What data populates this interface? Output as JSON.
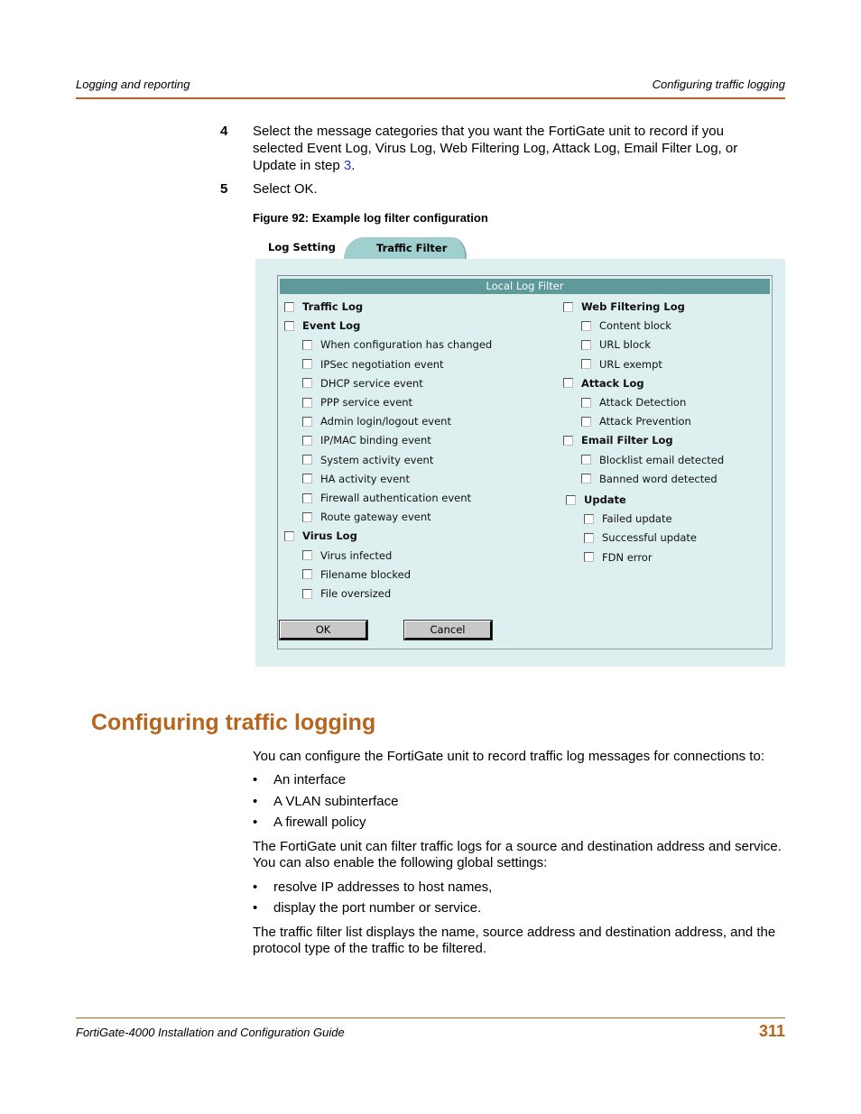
{
  "header": {
    "left": "Logging and reporting",
    "right": "Configuring traffic logging"
  },
  "steps": [
    {
      "num": "4",
      "text_before": "Select the message categories that you want the FortiGate unit to record if you selected Event Log, Virus Log, Web Filtering Log, Attack Log, Email Filter Log, or Update in step ",
      "link": "3",
      "text_after": "."
    },
    {
      "num": "5",
      "text": "Select OK."
    }
  ],
  "figure_caption": "Figure 92: Example log filter configuration",
  "screenshot": {
    "tabs": {
      "active": "Log Setting",
      "inactive": "Traffic Filter"
    },
    "panel_title": "Local Log Filter",
    "left_column": [
      {
        "label": "Traffic Log",
        "bold": true,
        "level": 0,
        "checked": false
      },
      {
        "label": "Event Log",
        "bold": true,
        "level": 0,
        "checked": false
      },
      {
        "label": "When configuration has changed",
        "bold": false,
        "level": 1,
        "checked": false
      },
      {
        "label": "IPSec negotiation event",
        "bold": false,
        "level": 1,
        "checked": false
      },
      {
        "label": "DHCP service event",
        "bold": false,
        "level": 1,
        "checked": false
      },
      {
        "label": "PPP service event",
        "bold": false,
        "level": 1,
        "checked": false
      },
      {
        "label": "Admin login/logout event",
        "bold": false,
        "level": 1,
        "checked": false
      },
      {
        "label": "IP/MAC binding event",
        "bold": false,
        "level": 1,
        "checked": false
      },
      {
        "label": "System activity event",
        "bold": false,
        "level": 1,
        "checked": false
      },
      {
        "label": "HA activity event",
        "bold": false,
        "level": 1,
        "checked": false
      },
      {
        "label": "Firewall authentication event",
        "bold": false,
        "level": 1,
        "checked": false
      },
      {
        "label": "Route gateway event",
        "bold": false,
        "level": 1,
        "checked": false
      },
      {
        "label": "Virus Log",
        "bold": true,
        "level": 0,
        "checked": false
      },
      {
        "label": "Virus infected",
        "bold": false,
        "level": 1,
        "checked": false
      },
      {
        "label": "Filename blocked",
        "bold": false,
        "level": 1,
        "checked": false
      },
      {
        "label": "File oversized",
        "bold": false,
        "level": 1,
        "checked": false
      }
    ],
    "right_column": [
      {
        "label": "Web Filtering Log",
        "bold": true,
        "level": 0,
        "checked": false
      },
      {
        "label": "Content block",
        "bold": false,
        "level": 1,
        "checked": false
      },
      {
        "label": "URL block",
        "bold": false,
        "level": 1,
        "checked": false
      },
      {
        "label": "URL exempt",
        "bold": false,
        "level": 1,
        "checked": false
      },
      {
        "label": "Attack Log",
        "bold": true,
        "level": 0,
        "checked": false
      },
      {
        "label": "Attack Detection",
        "bold": false,
        "level": 1,
        "checked": false
      },
      {
        "label": "Attack Prevention",
        "bold": false,
        "level": 1,
        "checked": false
      },
      {
        "label": "Email Filter Log",
        "bold": true,
        "level": 0,
        "checked": false
      },
      {
        "label": "Blocklist email detected",
        "bold": false,
        "level": 1,
        "checked": false
      },
      {
        "label": "Banned word detected",
        "bold": false,
        "level": 1,
        "checked": false
      },
      {
        "label": "Update",
        "bold": true,
        "level": 0,
        "checked": false
      },
      {
        "label": "Failed update",
        "bold": false,
        "level": 1,
        "checked": false
      },
      {
        "label": "Successful update",
        "bold": false,
        "level": 1,
        "checked": false
      },
      {
        "label": "FDN error",
        "bold": false,
        "level": 1,
        "checked": false
      }
    ],
    "buttons": {
      "ok": "OK",
      "cancel": "Cancel"
    }
  },
  "section_title": "Configuring traffic logging",
  "body": {
    "intro": "You can configure the FortiGate unit to record traffic log messages for connections to:",
    "bullets1": [
      "An interface",
      "A VLAN subinterface",
      "A firewall policy"
    ],
    "para2": "The FortiGate unit can filter traffic logs for a source and destination address and service. You can also enable the following global settings:",
    "bullets2": [
      "resolve IP addresses to host names,",
      "display the port number or service."
    ],
    "para3": "The traffic filter list displays the name, source address and destination address, and the protocol type of the traffic to be filtered."
  },
  "footer": {
    "left": "FortiGate-4000 Installation and Configuration Guide",
    "page": "311"
  },
  "colors": {
    "accent": "#b5651d",
    "panel_title_bg": "#5f9a9a",
    "screenshot_bg": "#ddf0ef",
    "tab_bg": "#9fcfcf",
    "link": "#2233cc"
  }
}
